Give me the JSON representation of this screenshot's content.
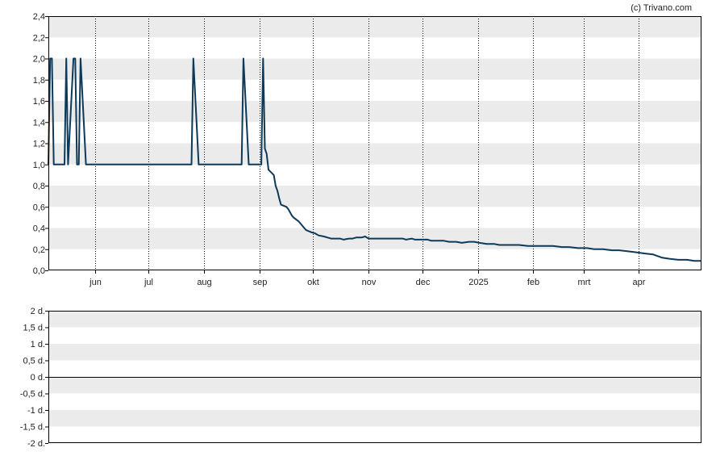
{
  "credit": "(c) Trivano.com",
  "colors": {
    "line": "#0d3a58",
    "band": "#ebebeb",
    "frame": "#000000",
    "vgrid": "#000000"
  },
  "chart_data": [
    {
      "type": "line",
      "title": "",
      "xlabel": "",
      "ylabel": "",
      "ylim": [
        0,
        2.4
      ],
      "y_ticks": [
        "0,0",
        "0,2",
        "0,4",
        "0,6",
        "0,8",
        "1,0",
        "1,2",
        "1,4",
        "1,6",
        "1,8",
        "2,0",
        "2,2",
        "2,4"
      ],
      "x_ticks": [
        "jun",
        "jul",
        "aug",
        "sep",
        "okt",
        "nov",
        "dec",
        "2025",
        "feb",
        "mrt",
        "apr"
      ],
      "x_range": [
        "2024-05-06",
        "2025-05-06"
      ],
      "x_tick_dates": [
        "2024-06-01",
        "2024-07-01",
        "2024-08-01",
        "2024-09-01",
        "2024-10-01",
        "2024-11-01",
        "2024-12-01",
        "2025-01-01",
        "2025-02-01",
        "2025-03-01",
        "2025-04-01"
      ],
      "grid": "alternating horizontal bands; dotted vertical lines at month ticks",
      "series": [
        {
          "x": [
            "2024-05-06",
            "2024-05-07",
            "2024-05-08",
            "2024-05-09",
            "2024-05-10",
            "2024-05-13",
            "2024-05-15",
            "2024-05-16",
            "2024-05-17",
            "2024-05-20",
            "2024-05-21",
            "2024-05-22",
            "2024-05-23",
            "2024-05-24",
            "2024-05-27",
            "2024-05-28",
            "2024-05-29",
            "2024-07-25",
            "2024-07-26",
            "2024-07-29",
            "2024-08-22",
            "2024-08-23",
            "2024-08-26",
            "2024-08-30",
            "2024-09-02",
            "2024-09-03",
            "2024-09-04",
            "2024-09-05",
            "2024-09-06",
            "2024-09-09",
            "2024-09-10",
            "2024-09-11",
            "2024-09-12",
            "2024-09-13",
            "2024-09-16",
            "2024-09-17",
            "2024-09-18",
            "2024-09-19",
            "2024-09-20",
            "2024-09-23",
            "2024-09-25",
            "2024-09-27",
            "2024-09-30",
            "2024-10-02",
            "2024-10-04",
            "2024-10-07",
            "2024-10-09",
            "2024-10-11",
            "2024-10-14",
            "2024-10-16",
            "2024-10-18",
            "2024-10-21",
            "2024-10-23",
            "2024-10-25",
            "2024-10-28",
            "2024-10-30",
            "2024-11-01",
            "2024-11-04",
            "2024-11-06",
            "2024-11-08",
            "2024-11-11",
            "2024-11-13",
            "2024-11-15",
            "2024-11-18",
            "2024-11-20",
            "2024-11-22",
            "2024-11-25",
            "2024-11-27",
            "2024-11-29",
            "2024-12-02",
            "2024-12-04",
            "2024-12-06",
            "2024-12-09",
            "2024-12-11",
            "2024-12-13",
            "2024-12-16",
            "2024-12-18",
            "2024-12-20",
            "2024-12-23",
            "2024-12-27",
            "2024-12-30",
            "2025-01-02",
            "2025-01-06",
            "2025-01-08",
            "2025-01-10",
            "2025-01-13",
            "2025-01-15",
            "2025-01-20",
            "2025-01-24",
            "2025-01-29",
            "2025-02-03",
            "2025-02-07",
            "2025-02-12",
            "2025-02-17",
            "2025-02-21",
            "2025-02-26",
            "2025-03-03",
            "2025-03-07",
            "2025-03-12",
            "2025-03-17",
            "2025-03-21",
            "2025-03-26",
            "2025-03-31",
            "2025-04-04",
            "2025-04-09",
            "2025-04-14",
            "2025-04-18",
            "2025-04-23",
            "2025-04-28",
            "2025-05-02",
            "2025-05-06"
          ],
          "y": [
            1.0,
            2.0,
            2.0,
            1.0,
            1.0,
            1.0,
            1.0,
            2.0,
            1.0,
            2.0,
            2.0,
            1.0,
            1.0,
            2.0,
            1.0,
            1.0,
            1.0,
            1.0,
            2.0,
            1.0,
            1.0,
            2.0,
            1.0,
            1.0,
            1.0,
            2.0,
            1.15,
            1.1,
            0.95,
            0.9,
            0.8,
            0.75,
            0.68,
            0.62,
            0.6,
            0.58,
            0.55,
            0.52,
            0.5,
            0.46,
            0.42,
            0.38,
            0.36,
            0.35,
            0.33,
            0.32,
            0.31,
            0.3,
            0.3,
            0.3,
            0.29,
            0.3,
            0.3,
            0.31,
            0.31,
            0.32,
            0.3,
            0.3,
            0.3,
            0.3,
            0.3,
            0.3,
            0.3,
            0.3,
            0.3,
            0.29,
            0.3,
            0.29,
            0.29,
            0.29,
            0.29,
            0.28,
            0.28,
            0.28,
            0.28,
            0.27,
            0.27,
            0.27,
            0.26,
            0.27,
            0.27,
            0.26,
            0.25,
            0.25,
            0.25,
            0.24,
            0.24,
            0.24,
            0.24,
            0.23,
            0.23,
            0.23,
            0.23,
            0.22,
            0.22,
            0.21,
            0.21,
            0.2,
            0.2,
            0.19,
            0.19,
            0.18,
            0.17,
            0.16,
            0.15,
            0.12,
            0.11,
            0.1,
            0.1,
            0.09,
            0.09
          ]
        }
      ]
    },
    {
      "type": "line",
      "title": "",
      "ylim": [
        -2,
        2
      ],
      "y_ticks": [
        "2 d.",
        "1,5 d.",
        "1 d.",
        "0,5 d.",
        "0 d.",
        "-0,5 d.",
        "-1 d.",
        "-1,5 d.",
        "-2 d."
      ],
      "grid": "alternating horizontal bands; solid line at 0 d.",
      "series": []
    }
  ]
}
